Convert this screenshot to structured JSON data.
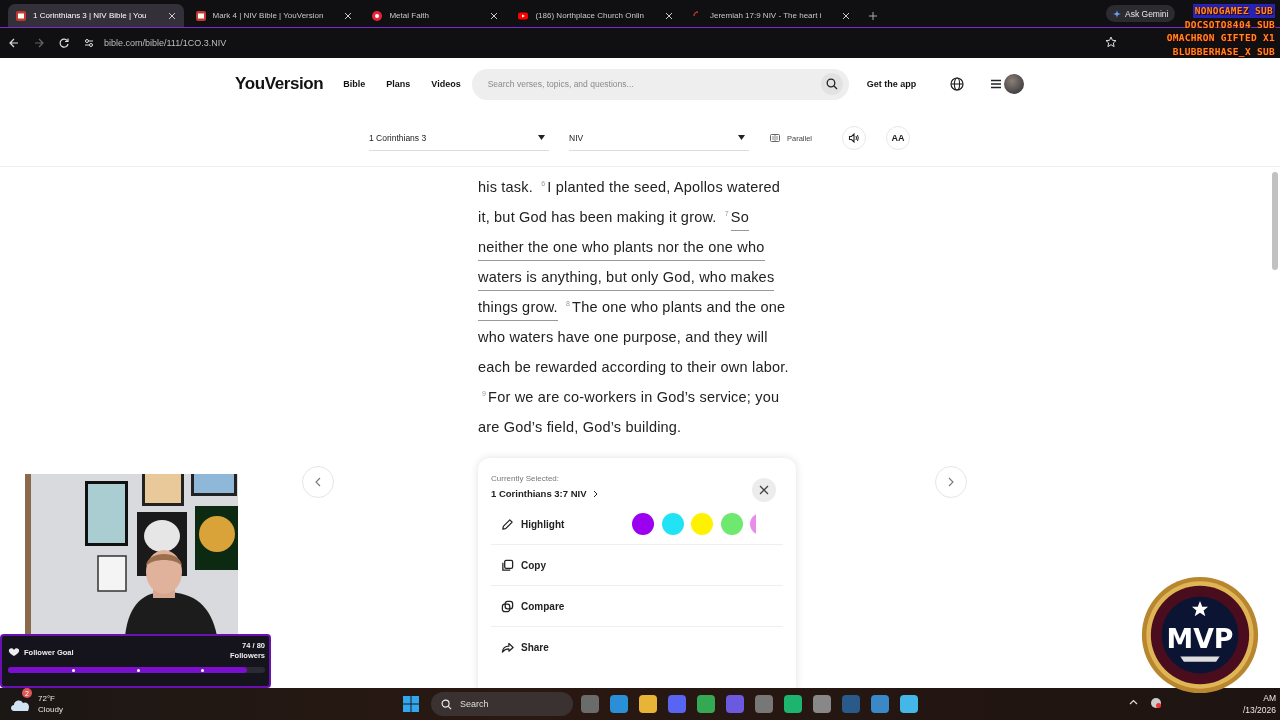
{
  "browser": {
    "tabs": [
      {
        "title": "1 Corinthians 3 | NIV Bible | You",
        "kind": "bible",
        "selected": true
      },
      {
        "title": "Mark 4 | NIV Bible | YouVersion",
        "kind": "bible",
        "selected": false
      },
      {
        "title": "Metal Faith",
        "kind": "music",
        "selected": false
      },
      {
        "title": "(186) Northplace Church Onlin",
        "kind": "video",
        "selected": false
      },
      {
        "title": "Jeremiah 17:9 NIV - The heart i",
        "kind": "loading",
        "selected": false
      }
    ],
    "gemini": "Ask Gemini",
    "url": "bible.com/bible/111/1CO.3.NIV"
  },
  "stream_alerts": [
    "NONOGAMEZ SUB",
    "DOCSOTO8404 SUB",
    "OMACHRON GIFTED X1",
    "BLUBBERHASE_X SUB"
  ],
  "site_header": {
    "logo": "YouVersion",
    "nav": [
      "Bible",
      "Plans",
      "Videos"
    ],
    "search": {
      "placeholder": "Search verses, topics, and questions..."
    },
    "get_app": "Get the app"
  },
  "reader_bar": {
    "book": "1 Corinthians 3",
    "version": "NIV",
    "parallel": "Parallel",
    "font_button": "AA"
  },
  "passage": [
    {
      "text": "his task.",
      "selected": false
    },
    {
      "number": "6",
      "text": "I planted the seed, Apollos watered it, but God has been making it grow.",
      "selected": false
    },
    {
      "number": "7",
      "text": "So neither the one who plants nor the one who waters is anything, but only God, who makes things grow.",
      "selected": true
    },
    {
      "number": "8",
      "text": "The one who plants and the one who waters have one purpose, and they will each be rewarded according to their own labor.",
      "selected": false
    },
    {
      "number": "9",
      "text": "For we are co-workers in God’s service; you are God’s field, God’s building.",
      "selected": false
    }
  ],
  "selection_panel": {
    "label": "Currently Selected:",
    "reference": "1 Corinthians 3:7 NIV",
    "highlight_label": "Highlight",
    "highlight_colors": [
      {
        "color": "#9b00f0"
      },
      {
        "color": "#22e3f5"
      },
      {
        "color": "#fff200"
      },
      {
        "color": "#6fe86f"
      },
      {
        "color": "#e88ee8"
      }
    ],
    "actions": [
      {
        "kind": "copy",
        "label": "Copy"
      },
      {
        "kind": "compare",
        "label": "Compare"
      },
      {
        "kind": "share",
        "label": "Share"
      }
    ]
  },
  "webcam": {
    "kind": "picture"
  },
  "follower_goal": {
    "title": "Follower Goal",
    "count": "74 / 80",
    "unit": "Followers",
    "level": 0.93
  },
  "mvp_badge": {
    "text": "MVP"
  },
  "taskbar": {
    "weather": {
      "temperature": "72°F",
      "condition": "Cloudy",
      "badge": "2"
    },
    "search": {
      "placeholder": "Search"
    },
    "clock": {
      "time": "AM",
      "date": "/13/2026"
    }
  }
}
